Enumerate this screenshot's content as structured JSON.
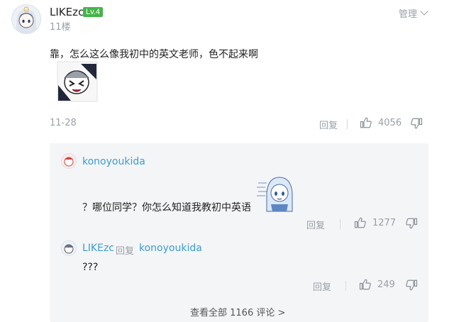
{
  "comment": {
    "username": "LIKEzc",
    "level": "Lv.4",
    "floor": "11楼",
    "manage_label": "管理",
    "text": "靠，怎么这么像我初中的英文老师，色不起来啊",
    "date": "11-28",
    "reply_label": "回复",
    "like_count": "4056"
  },
  "replies": [
    {
      "username": "konoyoukida",
      "text": "？哪位同学？你怎么知道我教初中英语",
      "reply_label": "回复",
      "like_count": "1277"
    },
    {
      "username": "LIKEzc",
      "reply_word": "回复",
      "reply_to": "konoyoukida",
      "text": "???",
      "reply_label": "回复",
      "like_count": "249"
    }
  ],
  "more_comments": "查看全部 1166 评论 >",
  "colors": {
    "accent": "#3a9dd4",
    "level_badge": "#44b549",
    "muted": "#9aa0a6",
    "reply_bg": "#f4f5f7"
  },
  "icons": [
    "thumb-up-icon",
    "thumb-down-icon",
    "chevron-down-icon"
  ]
}
